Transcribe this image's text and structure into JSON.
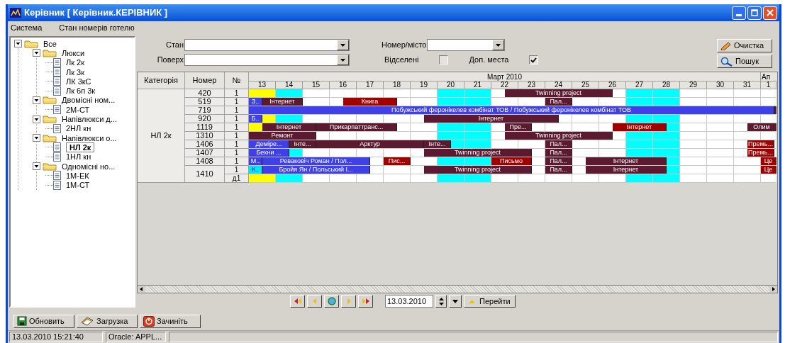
{
  "window": {
    "title": "Керівник [ Керівник.КЕРІВНИК ]"
  },
  "menu": [
    "Система",
    "Стан номерів готелю"
  ],
  "tree": [
    {
      "label": "Все",
      "expanded": true,
      "selected": false,
      "children": [
        {
          "label": "Люкси",
          "expanded": true,
          "selected": false,
          "children": [
            {
              "label": "Лк 2к",
              "selected": false
            },
            {
              "label": "Лк 3к",
              "selected": false
            },
            {
              "label": "ЛК 3кС",
              "selected": false
            },
            {
              "label": "Лк 6п 3к",
              "selected": false
            }
          ]
        },
        {
          "label": "Двомісні ном...",
          "expanded": true,
          "selected": false,
          "children": [
            {
              "label": "2М-СТ",
              "selected": false
            }
          ]
        },
        {
          "label": "Напівлюкси д...",
          "expanded": true,
          "selected": false,
          "children": [
            {
              "label": "2НЛ кн",
              "selected": false
            }
          ]
        },
        {
          "label": "Напівлюкси о...",
          "expanded": true,
          "selected": false,
          "children": [
            {
              "label": "НЛ 2к",
              "selected": true
            },
            {
              "label": "1НЛ кн",
              "selected": false
            }
          ]
        },
        {
          "label": "Одномісні но...",
          "expanded": true,
          "selected": false,
          "children": [
            {
              "label": "1М-ЕК",
              "selected": false
            },
            {
              "label": "1М-СТ",
              "selected": false
            }
          ]
        }
      ]
    }
  ],
  "filters": {
    "state": {
      "label": "Стан"
    },
    "floor": {
      "label": "Поверх"
    },
    "room": {
      "label": "Номер/місто"
    },
    "checkboxes": [
      {
        "label": "Відселені",
        "checked": false
      },
      {
        "label": "Доп. места",
        "checked": true
      }
    ],
    "buttons": [
      "Очистка",
      "Пошук"
    ]
  },
  "grid": {
    "columns": [
      "Категорія",
      "Номер",
      "№"
    ],
    "month": "Март 2010",
    "next_month": "Ап",
    "days": [
      {
        "label": "13",
        "kind": "today"
      },
      {
        "label": "14",
        "kind": "weekend"
      },
      {
        "label": "15",
        "kind": "normal"
      },
      {
        "label": "16",
        "kind": "normal"
      },
      {
        "label": "17",
        "kind": "normal"
      },
      {
        "label": "18",
        "kind": "normal"
      },
      {
        "label": "19",
        "kind": "normal"
      },
      {
        "label": "20",
        "kind": "weekend"
      },
      {
        "label": "21",
        "kind": "weekend"
      },
      {
        "label": "22",
        "kind": "normal"
      },
      {
        "label": "23",
        "kind": "normal"
      },
      {
        "label": "24",
        "kind": "normal"
      },
      {
        "label": "25",
        "kind": "normal"
      },
      {
        "label": "26",
        "kind": "normal"
      },
      {
        "label": "27",
        "kind": "weekend"
      },
      {
        "label": "28",
        "kind": "weekend"
      },
      {
        "label": "29",
        "kind": "normal"
      },
      {
        "label": "30",
        "kind": "normal"
      },
      {
        "label": "31",
        "kind": "normal"
      },
      {
        "label": "1",
        "kind": "normal"
      }
    ],
    "category": "НЛ 2к",
    "rooms": [
      {
        "number": "420",
        "beds": [
          {
            "label": "1",
            "segments": [
              {
                "kind": "free"
              },
              {
                "kind": "free"
              },
              {
                "kind": "free"
              },
              {
                "kind": "free"
              },
              {
                "kind": "free"
              },
              {
                "kind": "free"
              },
              {
                "kind": "free"
              },
              {
                "kind": "free"
              },
              {
                "kind": "free"
              },
              {
                "kind": "free"
              },
              {
                "kind": "free"
              },
              {
                "kind": "free"
              },
              {
                "kind": "free"
              },
              {
                "kind": "free"
              },
              {
                "kind": "free"
              },
              {
                "kind": "free"
              },
              {
                "kind": "free"
              },
              {
                "kind": "free"
              },
              {
                "kind": "free"
              },
              {
                "kind": "booking",
                "label": "Twinning project",
                "color": "#5c1a30"
              },
              {
                "kind": "more"
              },
              {
                "kind": "more"
              },
              {
                "kind": "more"
              },
              {
                "kind": "more"
              },
              {
                "kind": "more"
              },
              {
                "kind": "more"
              },
              {
                "kind": "more"
              }
            ]
          }
        ]
      },
      {
        "number": "519",
        "beds": [
          {
            "label": "1",
            "segments": [
              {
                "kind": "booking",
                "label": "З..",
                "color": "#4040e8"
              },
              {
                "kind": "booking",
                "label": "Інтернет",
                "color": "#5c1a30"
              },
              {
                "kind": "more"
              },
              {
                "kind": "more"
              },
              {
                "kind": "free"
              },
              {
                "kind": "free"
              },
              {
                "kind": "free"
              },
              {
                "kind": "booking",
                "label": "Книга",
                "color": "#a00000"
              },
              {
                "kind": "more"
              },
              {
                "kind": "more"
              },
              {
                "kind": "more"
              },
              {
                "kind": "free"
              },
              {
                "kind": "free"
              },
              {
                "kind": "free"
              },
              {
                "kind": "free"
              },
              {
                "kind": "free"
              },
              {
                "kind": "free"
              },
              {
                "kind": "free"
              },
              {
                "kind": "free"
              },
              {
                "kind": "free"
              },
              {
                "kind": "free"
              },
              {
                "kind": "free"
              },
              {
                "kind": "booking",
                "label": "Пал...",
                "color": "#5c1a30"
              },
              {
                "kind": "more"
              }
            ]
          }
        ]
      },
      {
        "number": "719",
        "beds": [
          {
            "label": "1",
            "segments": [
              {
                "kind": "booking",
                "label": "Побужський феронікелев комбінат ТОВ / Побужський феронікелев комбінат ТОВ",
                "color": "#4040e8"
              },
              {
                "kind": "more"
              },
              {
                "kind": "more"
              },
              {
                "kind": "more"
              },
              {
                "kind": "more"
              },
              {
                "kind": "more"
              },
              {
                "kind": "more"
              },
              {
                "kind": "more"
              },
              {
                "kind": "more"
              },
              {
                "kind": "more"
              },
              {
                "kind": "more"
              },
              {
                "kind": "more"
              },
              {
                "kind": "more"
              },
              {
                "kind": "more"
              },
              {
                "kind": "more"
              },
              {
                "kind": "more"
              },
              {
                "kind": "more"
              },
              {
                "kind": "more"
              },
              {
                "kind": "more"
              },
              {
                "kind": "more"
              },
              {
                "kind": "more"
              },
              {
                "kind": "more"
              },
              {
                "kind": "more"
              },
              {
                "kind": "more"
              },
              {
                "kind": "more"
              },
              {
                "kind": "more"
              },
              {
                "kind": "more"
              },
              {
                "kind": "more"
              },
              {
                "kind": "more"
              },
              {
                "kind": "more"
              },
              {
                "kind": "more"
              },
              {
                "kind": "more"
              },
              {
                "kind": "more"
              },
              {
                "kind": "more"
              },
              {
                "kind": "more"
              },
              {
                "kind": "more"
              },
              {
                "kind": "more"
              },
              {
                "kind": "more"
              },
              {
                "kind": "more"
              },
              {
                "kind": "booking",
                "color": "#5c1a30"
              }
            ]
          }
        ]
      },
      {
        "number": "920",
        "beds": [
          {
            "label": "1",
            "segments": [
              {
                "kind": "booking",
                "label": "Б..",
                "color": "#4040e8"
              },
              {
                "kind": "free"
              },
              {
                "kind": "free"
              },
              {
                "kind": "free"
              },
              {
                "kind": "free"
              },
              {
                "kind": "free"
              },
              {
                "kind": "free"
              },
              {
                "kind": "free"
              },
              {
                "kind": "free"
              },
              {
                "kind": "free"
              },
              {
                "kind": "free"
              },
              {
                "kind": "free"
              },
              {
                "kind": "free"
              },
              {
                "kind": "booking",
                "label": "Інтернет",
                "color": "#5c1a30"
              },
              {
                "kind": "more"
              },
              {
                "kind": "more"
              },
              {
                "kind": "more"
              },
              {
                "kind": "more"
              },
              {
                "kind": "more"
              },
              {
                "kind": "more"
              },
              {
                "kind": "more"
              },
              {
                "kind": "more"
              },
              {
                "kind": "more"
              }
            ]
          }
        ]
      },
      {
        "number": "1119",
        "beds": [
          {
            "label": "1",
            "segments": [
              {
                "kind": "free"
              },
              {
                "kind": "booking",
                "label": "Інтернет",
                "color": "#5c1a30"
              },
              {
                "kind": "more"
              },
              {
                "kind": "more"
              },
              {
                "kind": "more"
              },
              {
                "kind": "booking",
                "label": "Прикарпаттранс...",
                "color": "#5c1a30"
              },
              {
                "kind": "more"
              },
              {
                "kind": "more"
              },
              {
                "kind": "more"
              },
              {
                "kind": "more"
              },
              {
                "kind": "more"
              },
              {
                "kind": "free"
              },
              {
                "kind": "free"
              },
              {
                "kind": "free"
              },
              {
                "kind": "free"
              },
              {
                "kind": "free"
              },
              {
                "kind": "free"
              },
              {
                "kind": "free"
              },
              {
                "kind": "free"
              },
              {
                "kind": "booking",
                "label": "Пре...",
                "color": "#5c1a30"
              },
              {
                "kind": "more"
              },
              {
                "kind": "free"
              },
              {
                "kind": "free"
              },
              {
                "kind": "free"
              },
              {
                "kind": "free"
              },
              {
                "kind": "free"
              },
              {
                "kind": "free"
              },
              {
                "kind": "booking",
                "label": "Інтернет",
                "color": "#a00000"
              },
              {
                "kind": "more"
              },
              {
                "kind": "more"
              },
              {
                "kind": "more"
              },
              {
                "kind": "free"
              },
              {
                "kind": "free"
              },
              {
                "kind": "free"
              },
              {
                "kind": "free"
              },
              {
                "kind": "free"
              },
              {
                "kind": "free"
              },
              {
                "kind": "booking",
                "label": "Олим",
                "color": "#5c1a30"
              },
              {
                "kind": "more"
              },
              {
                "kind": "more"
              }
            ]
          }
        ]
      },
      {
        "number": "1310",
        "beds": [
          {
            "label": "1",
            "segments": [
              {
                "kind": "booking",
                "label": "Ремонт",
                "color": "#5c1a30"
              },
              {
                "kind": "more"
              },
              {
                "kind": "more"
              },
              {
                "kind": "more"
              },
              {
                "kind": "more"
              },
              {
                "kind": "free"
              },
              {
                "kind": "free"
              },
              {
                "kind": "free"
              },
              {
                "kind": "free"
              },
              {
                "kind": "free"
              },
              {
                "kind": "free"
              },
              {
                "kind": "free"
              },
              {
                "kind": "free"
              },
              {
                "kind": "free"
              },
              {
                "kind": "free"
              },
              {
                "kind": "free"
              },
              {
                "kind": "free"
              },
              {
                "kind": "free"
              },
              {
                "kind": "free"
              },
              {
                "kind": "booking",
                "label": "Twinning project",
                "color": "#5c1a30"
              },
              {
                "kind": "more"
              },
              {
                "kind": "more"
              },
              {
                "kind": "more"
              },
              {
                "kind": "more"
              },
              {
                "kind": "more"
              },
              {
                "kind": "more"
              },
              {
                "kind": "more"
              }
            ]
          }
        ]
      },
      {
        "number": "1406",
        "beds": [
          {
            "label": "1",
            "segments": [
              {
                "kind": "booking",
                "label": "Деміре...",
                "color": "#4040e8"
              },
              {
                "kind": "more"
              },
              {
                "kind": "more"
              },
              {
                "kind": "booking",
                "label": "Інте...",
                "color": "#5c1a30"
              },
              {
                "kind": "more"
              },
              {
                "kind": "booking",
                "label": "Арктур",
                "color": "#5c1a30"
              },
              {
                "kind": "more"
              },
              {
                "kind": "more"
              },
              {
                "kind": "more"
              },
              {
                "kind": "more"
              },
              {
                "kind": "more"
              },
              {
                "kind": "more"
              },
              {
                "kind": "more"
              },
              {
                "kind": "booking",
                "label": "Інте...",
                "color": "#5c1a30"
              },
              {
                "kind": "more"
              },
              {
                "kind": "free"
              },
              {
                "kind": "free"
              },
              {
                "kind": "free"
              },
              {
                "kind": "free"
              },
              {
                "kind": "free"
              },
              {
                "kind": "free"
              },
              {
                "kind": "free"
              },
              {
                "kind": "booking",
                "label": "Пал...",
                "color": "#5c1a30"
              },
              {
                "kind": "more"
              },
              {
                "kind": "free"
              },
              {
                "kind": "free"
              },
              {
                "kind": "free"
              },
              {
                "kind": "free"
              },
              {
                "kind": "free"
              },
              {
                "kind": "free"
              },
              {
                "kind": "free"
              },
              {
                "kind": "free"
              },
              {
                "kind": "free"
              },
              {
                "kind": "free"
              },
              {
                "kind": "free"
              },
              {
                "kind": "free"
              },
              {
                "kind": "free"
              },
              {
                "kind": "booking",
                "label": "Премь...",
                "color": "#a00000"
              },
              {
                "kind": "more"
              }
            ]
          }
        ]
      },
      {
        "number": "1407",
        "beds": [
          {
            "label": "1",
            "segments": [
              {
                "kind": "booking",
                "label": "Бехни ...",
                "color": "#4040e8"
              },
              {
                "kind": "more"
              },
              {
                "kind": "more"
              },
              {
                "kind": "free"
              },
              {
                "kind": "free"
              },
              {
                "kind": "free"
              },
              {
                "kind": "free"
              },
              {
                "kind": "free"
              },
              {
                "kind": "free"
              },
              {
                "kind": "free"
              },
              {
                "kind": "free"
              },
              {
                "kind": "free"
              },
              {
                "kind": "free"
              },
              {
                "kind": "booking",
                "label": "Twinning project",
                "color": "#5c1a30"
              },
              {
                "kind": "more"
              },
              {
                "kind": "more"
              },
              {
                "kind": "more"
              },
              {
                "kind": "more"
              },
              {
                "kind": "more"
              },
              {
                "kind": "more"
              },
              {
                "kind": "more"
              },
              {
                "kind": "free"
              },
              {
                "kind": "booking",
                "label": "Пал...",
                "color": "#5c1a30"
              },
              {
                "kind": "more"
              },
              {
                "kind": "free"
              },
              {
                "kind": "free"
              },
              {
                "kind": "free"
              },
              {
                "kind": "free"
              },
              {
                "kind": "free"
              },
              {
                "kind": "free"
              },
              {
                "kind": "free"
              },
              {
                "kind": "free"
              },
              {
                "kind": "free"
              },
              {
                "kind": "free"
              },
              {
                "kind": "free"
              },
              {
                "kind": "free"
              },
              {
                "kind": "free"
              },
              {
                "kind": "booking",
                "label": "Премь...",
                "color": "#a00000"
              },
              {
                "kind": "more"
              }
            ]
          }
        ]
      },
      {
        "number": "1408",
        "beds": [
          {
            "label": "1",
            "segments": [
              {
                "kind": "booking",
                "label": "М..",
                "color": "#4040e8"
              },
              {
                "kind": "booking",
                "label": "Реваковіч Роман / Пол...",
                "color": "#4040e8"
              },
              {
                "kind": "more"
              },
              {
                "kind": "more"
              },
              {
                "kind": "more"
              },
              {
                "kind": "more"
              },
              {
                "kind": "more"
              },
              {
                "kind": "more"
              },
              {
                "kind": "more"
              },
              {
                "kind": "free"
              },
              {
                "kind": "booking",
                "label": "Пис...",
                "color": "#a00000"
              },
              {
                "kind": "more"
              },
              {
                "kind": "free"
              },
              {
                "kind": "free"
              },
              {
                "kind": "free"
              },
              {
                "kind": "free"
              },
              {
                "kind": "free"
              },
              {
                "kind": "free"
              },
              {
                "kind": "booking",
                "label": "Письмо",
                "color": "#a00000"
              },
              {
                "kind": "more"
              },
              {
                "kind": "more"
              },
              {
                "kind": "free"
              },
              {
                "kind": "booking",
                "label": "Пал...",
                "color": "#5c1a30"
              },
              {
                "kind": "more"
              },
              {
                "kind": "free"
              },
              {
                "kind": "booking",
                "label": "Інтернет",
                "color": "#5c1a30"
              },
              {
                "kind": "more"
              },
              {
                "kind": "more"
              },
              {
                "kind": "more"
              },
              {
                "kind": "more"
              },
              {
                "kind": "more"
              },
              {
                "kind": "free"
              },
              {
                "kind": "free"
              },
              {
                "kind": "free"
              },
              {
                "kind": "free"
              },
              {
                "kind": "free"
              },
              {
                "kind": "free"
              },
              {
                "kind": "free"
              },
              {
                "kind": "booking",
                "label": "Це",
                "color": "#a00000"
              },
              {
                "kind": "more"
              }
            ]
          }
        ]
      },
      {
        "number": "1410",
        "beds": [
          {
            "label": "1",
            "segments": [
              {
                "kind": "booking",
                "label": "К..",
                "color": "#00e8f0"
              },
              {
                "kind": "booking",
                "label": "Бройя Ян / Польський І...",
                "color": "#4040e8"
              },
              {
                "kind": "more"
              },
              {
                "kind": "more"
              },
              {
                "kind": "more"
              },
              {
                "kind": "more"
              },
              {
                "kind": "more"
              },
              {
                "kind": "more"
              },
              {
                "kind": "more"
              },
              {
                "kind": "free"
              },
              {
                "kind": "free"
              },
              {
                "kind": "free"
              },
              {
                "kind": "free"
              },
              {
                "kind": "booking",
                "label": "Twinning project",
                "color": "#5c1a30"
              },
              {
                "kind": "more"
              },
              {
                "kind": "more"
              },
              {
                "kind": "more"
              },
              {
                "kind": "more"
              },
              {
                "kind": "more"
              },
              {
                "kind": "more"
              },
              {
                "kind": "more"
              },
              {
                "kind": "free"
              },
              {
                "kind": "booking",
                "label": "Пал...",
                "color": "#5c1a30"
              },
              {
                "kind": "more"
              },
              {
                "kind": "free"
              },
              {
                "kind": "booking",
                "label": "Інтернет",
                "color": "#5c1a30"
              },
              {
                "kind": "more"
              },
              {
                "kind": "more"
              },
              {
                "kind": "more"
              },
              {
                "kind": "more"
              },
              {
                "kind": "more"
              },
              {
                "kind": "free"
              },
              {
                "kind": "free"
              },
              {
                "kind": "free"
              },
              {
                "kind": "free"
              },
              {
                "kind": "free"
              },
              {
                "kind": "free"
              },
              {
                "kind": "free"
              },
              {
                "kind": "booking",
                "label": "Це",
                "color": "#a00000"
              },
              {
                "kind": "more"
              }
            ]
          },
          {
            "label": "д1"
          }
        ]
      }
    ]
  },
  "navigator": {
    "date": "13.03.2010",
    "go": "Перейти"
  },
  "bottom_buttons": [
    "Обновить",
    "Загрузка",
    "Зачиніть"
  ],
  "status_bar": [
    "13.03.2010 15:21:40",
    "Oracle: APPL..."
  ]
}
